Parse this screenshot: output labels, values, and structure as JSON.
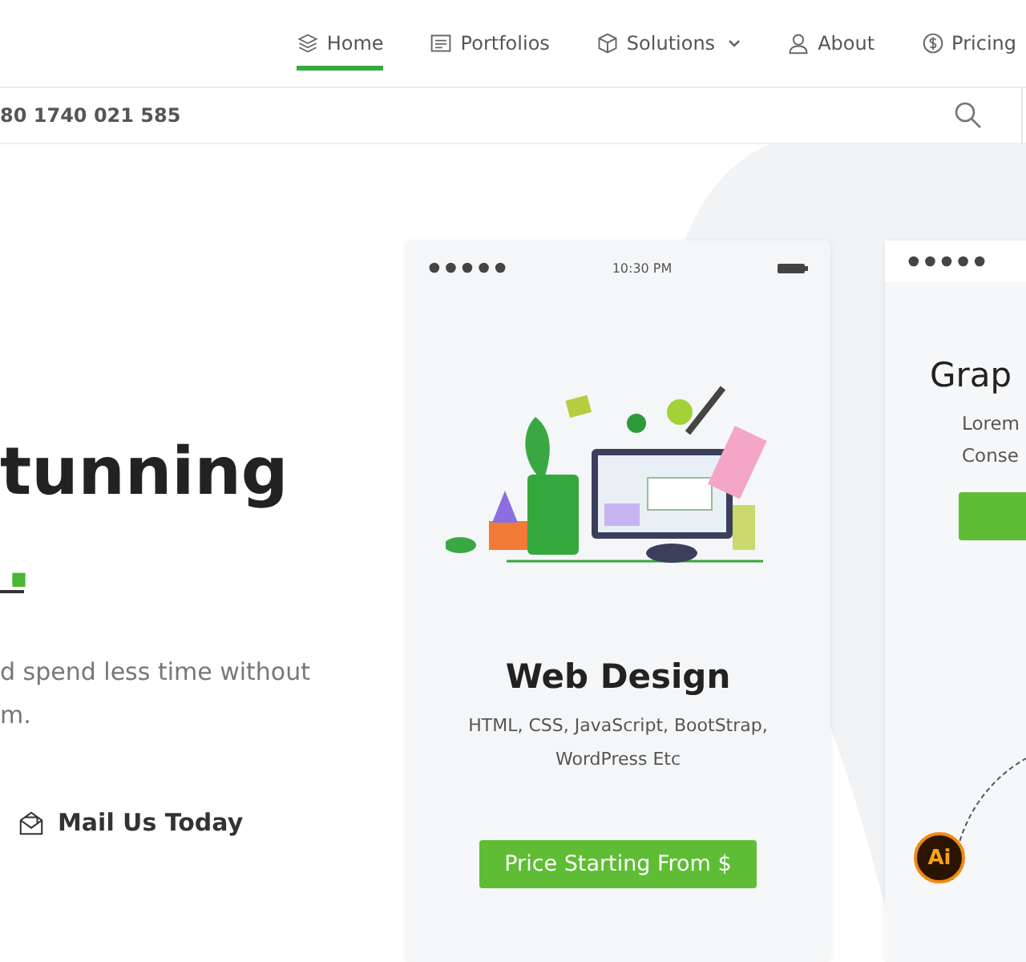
{
  "nav": {
    "items": [
      {
        "label": "Home",
        "selected": true,
        "dropdown": false
      },
      {
        "label": "Portfolios",
        "selected": false,
        "dropdown": false
      },
      {
        "label": "Solutions",
        "selected": false,
        "dropdown": true
      },
      {
        "label": "About",
        "selected": false,
        "dropdown": false
      },
      {
        "label": "Pricing",
        "selected": false,
        "dropdown": false
      }
    ]
  },
  "topbar": {
    "phone": "80 1740 021 585"
  },
  "hero": {
    "headline": "tunning",
    "headline_end": ".",
    "text_lines": [
      "d spend less time without",
      "m."
    ],
    "mail_link": "Mail Us Today"
  },
  "cards": [
    {
      "time": "10:30 PM",
      "title": "Web Design",
      "description_lines": [
        "HTML, CSS, JavaScript, BootStrap,",
        "WordPress Etc"
      ],
      "button": "Price Starting From $"
    },
    {
      "title": "Grap",
      "description_lines": [
        "Lorem",
        "Conse"
      ],
      "badge": "Ai"
    }
  ]
}
